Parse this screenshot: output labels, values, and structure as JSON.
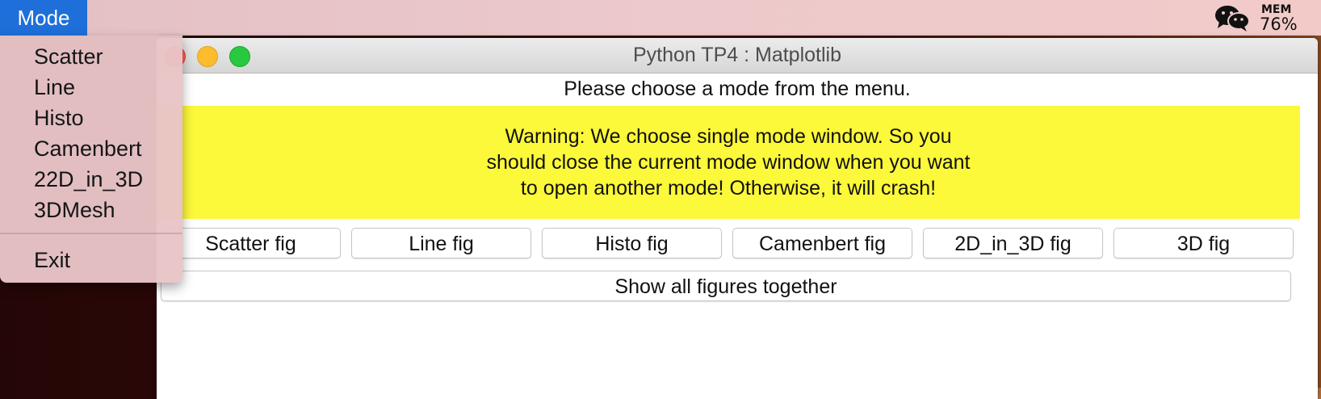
{
  "menubar": {
    "app_menu": "Mode",
    "wechat_icon": "wechat-icon",
    "mem_label": "MEM",
    "mem_value": "76%"
  },
  "dropdown": {
    "items": [
      "Scatter",
      "Line",
      "Histo",
      "Camenbert",
      "22D_in_3D",
      "3DMesh"
    ],
    "exit": "Exit"
  },
  "window": {
    "title": "Python TP4 : Matplotlib",
    "instruction": "Please choose a mode from the menu.",
    "warning": "Warning: We choose single mode window. So you should close the current mode window when you want to open another mode! Otherwise, it will crash!",
    "warning_color": "#fcf83a",
    "fig_buttons": [
      "Scatter fig",
      "Line fig",
      "Histo fig",
      "Camenbert fig",
      "2D_in_3D fig",
      "3D fig"
    ],
    "show_all": "Show all figures together"
  },
  "colors": {
    "menu_highlight": "#1e6fd9",
    "close": "#fc5f57",
    "minimize": "#fdbc2e",
    "maximize": "#28c840"
  }
}
